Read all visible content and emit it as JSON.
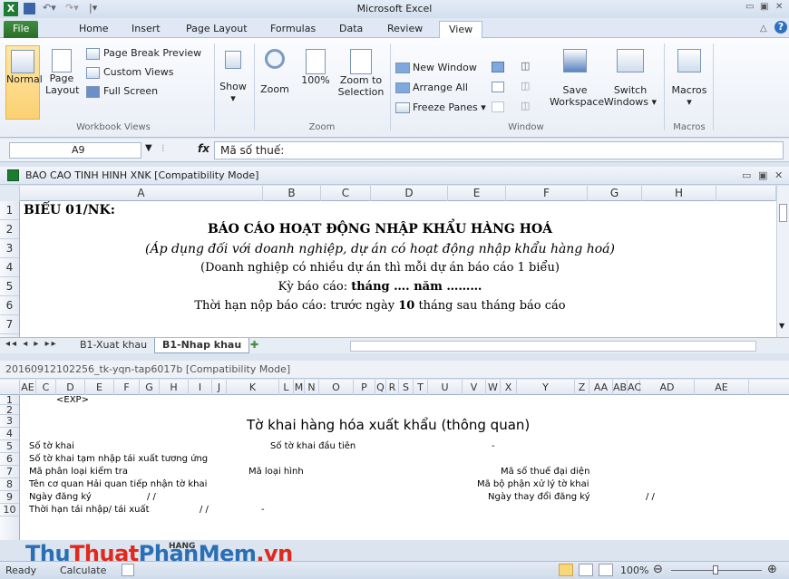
{
  "app": {
    "title": "Microsoft Excel"
  },
  "ribbon_tabs": [
    "File",
    "Home",
    "Insert",
    "Page Layout",
    "Formulas",
    "Data",
    "Review",
    "View"
  ],
  "active_tab": "View",
  "ribbon": {
    "workbook_views": {
      "normal": "Normal",
      "page_layout_1": "Page",
      "page_layout_2": "Layout",
      "page_break": "Page Break Preview",
      "custom_views": "Custom Views",
      "full_screen": "Full Screen",
      "group": "Workbook Views"
    },
    "show": {
      "label": "Show"
    },
    "zoom": {
      "zoom": "Zoom",
      "hundred": "100%",
      "selection_1": "Zoom to",
      "selection_2": "Selection",
      "group": "Zoom"
    },
    "window": {
      "new_window": "New Window",
      "arrange_all": "Arrange All",
      "freeze_panes": "Freeze Panes",
      "save_ws_1": "Save",
      "save_ws_2": "Workspace",
      "switch_1": "Switch",
      "switch_2": "Windows",
      "group": "Window"
    },
    "macros": {
      "label": "Macros",
      "group": "Macros"
    }
  },
  "formula_bar": {
    "name_box": "A9",
    "fx": "fx",
    "value": "Mã số thuế:"
  },
  "win1": {
    "title": "BAO CAO TINH HINH XNK  [Compatibility Mode]",
    "columns": [
      "A",
      "B",
      "C",
      "D",
      "E",
      "F",
      "G",
      "H"
    ],
    "rows": [
      "1",
      "2",
      "3",
      "4",
      "5",
      "6",
      "7"
    ],
    "cells": {
      "r1": "BIỂU 01/NK:",
      "r2": "BÁO CÁO HOẠT ĐỘNG NHẬP KHẨU HÀNG HOÁ",
      "r3": "(Áp dụng đối với doanh nghiệp, dự án có hoạt động nhập khẩu hàng hoá)",
      "r4": "(Doanh nghiệp có nhiều dự án thì mỗi dự án báo cáo 1 biểu)",
      "r5_pre": "Kỳ báo cáo: ",
      "r5_bold": "tháng …. năm ………",
      "r6_pre": "Thời hạn nộp báo cáo: trước ngày ",
      "r6_bold": "10",
      "r6_post": " tháng sau tháng báo cáo"
    },
    "sheet_tabs": [
      "B1-Xuat khau",
      "B1-Nhap khau"
    ],
    "active_sheet": "B1-Nhap khau"
  },
  "win2": {
    "title": "20160912102256_tk-yqn-tap6017b  [Compatibility Mode]",
    "columns": [
      "AE",
      "C",
      "D",
      "E",
      "F",
      "G",
      "H",
      "I",
      "J",
      "K",
      "L",
      "M",
      "N",
      "O",
      "P",
      "Q",
      "R",
      "S",
      "T",
      "U",
      "V",
      "W",
      "X",
      "Y",
      "Z",
      "AA",
      "AB",
      "AC",
      "AD",
      "AE"
    ],
    "rows": [
      "1",
      "2",
      "3",
      "4",
      "5",
      "6",
      "7",
      "8",
      "9",
      "10"
    ],
    "cells": {
      "r1": "<EXP>",
      "title": "Tờ khai hàng hóa xuất khẩu (thông quan)",
      "r4a": "Số tờ khai",
      "r4b": "Số tờ khai đầu tiên",
      "r4c": "-",
      "r5a": "Số tờ khai tạm nhập tái xuất tương ứng",
      "r6a": "Mã phân loại kiểm tra",
      "r6b": "Mã loại hình",
      "r6c": "Mã số thuế đại diện",
      "r7a": "Tên cơ quan Hải quan tiếp nhận tờ khai",
      "r7c": "Mã bộ phận xử lý tờ khai",
      "r8a": "Ngày đăng ký",
      "r8s": "/          /",
      "r8c": "Ngày thay đổi đăng ký",
      "r8d": "/          /",
      "r9a": "Thời hạn tái nhập/ tái xuất",
      "r9s": "/          /",
      "r9d": "-"
    },
    "sheet_tab": "HANG"
  },
  "status": {
    "ready": "Ready",
    "calculate": "Calculate",
    "zoom": "100%"
  },
  "watermark": {
    "blue1": "Thu",
    "red1": "Thuat",
    "blue2": "PhanMem",
    "red2": ".vn"
  }
}
